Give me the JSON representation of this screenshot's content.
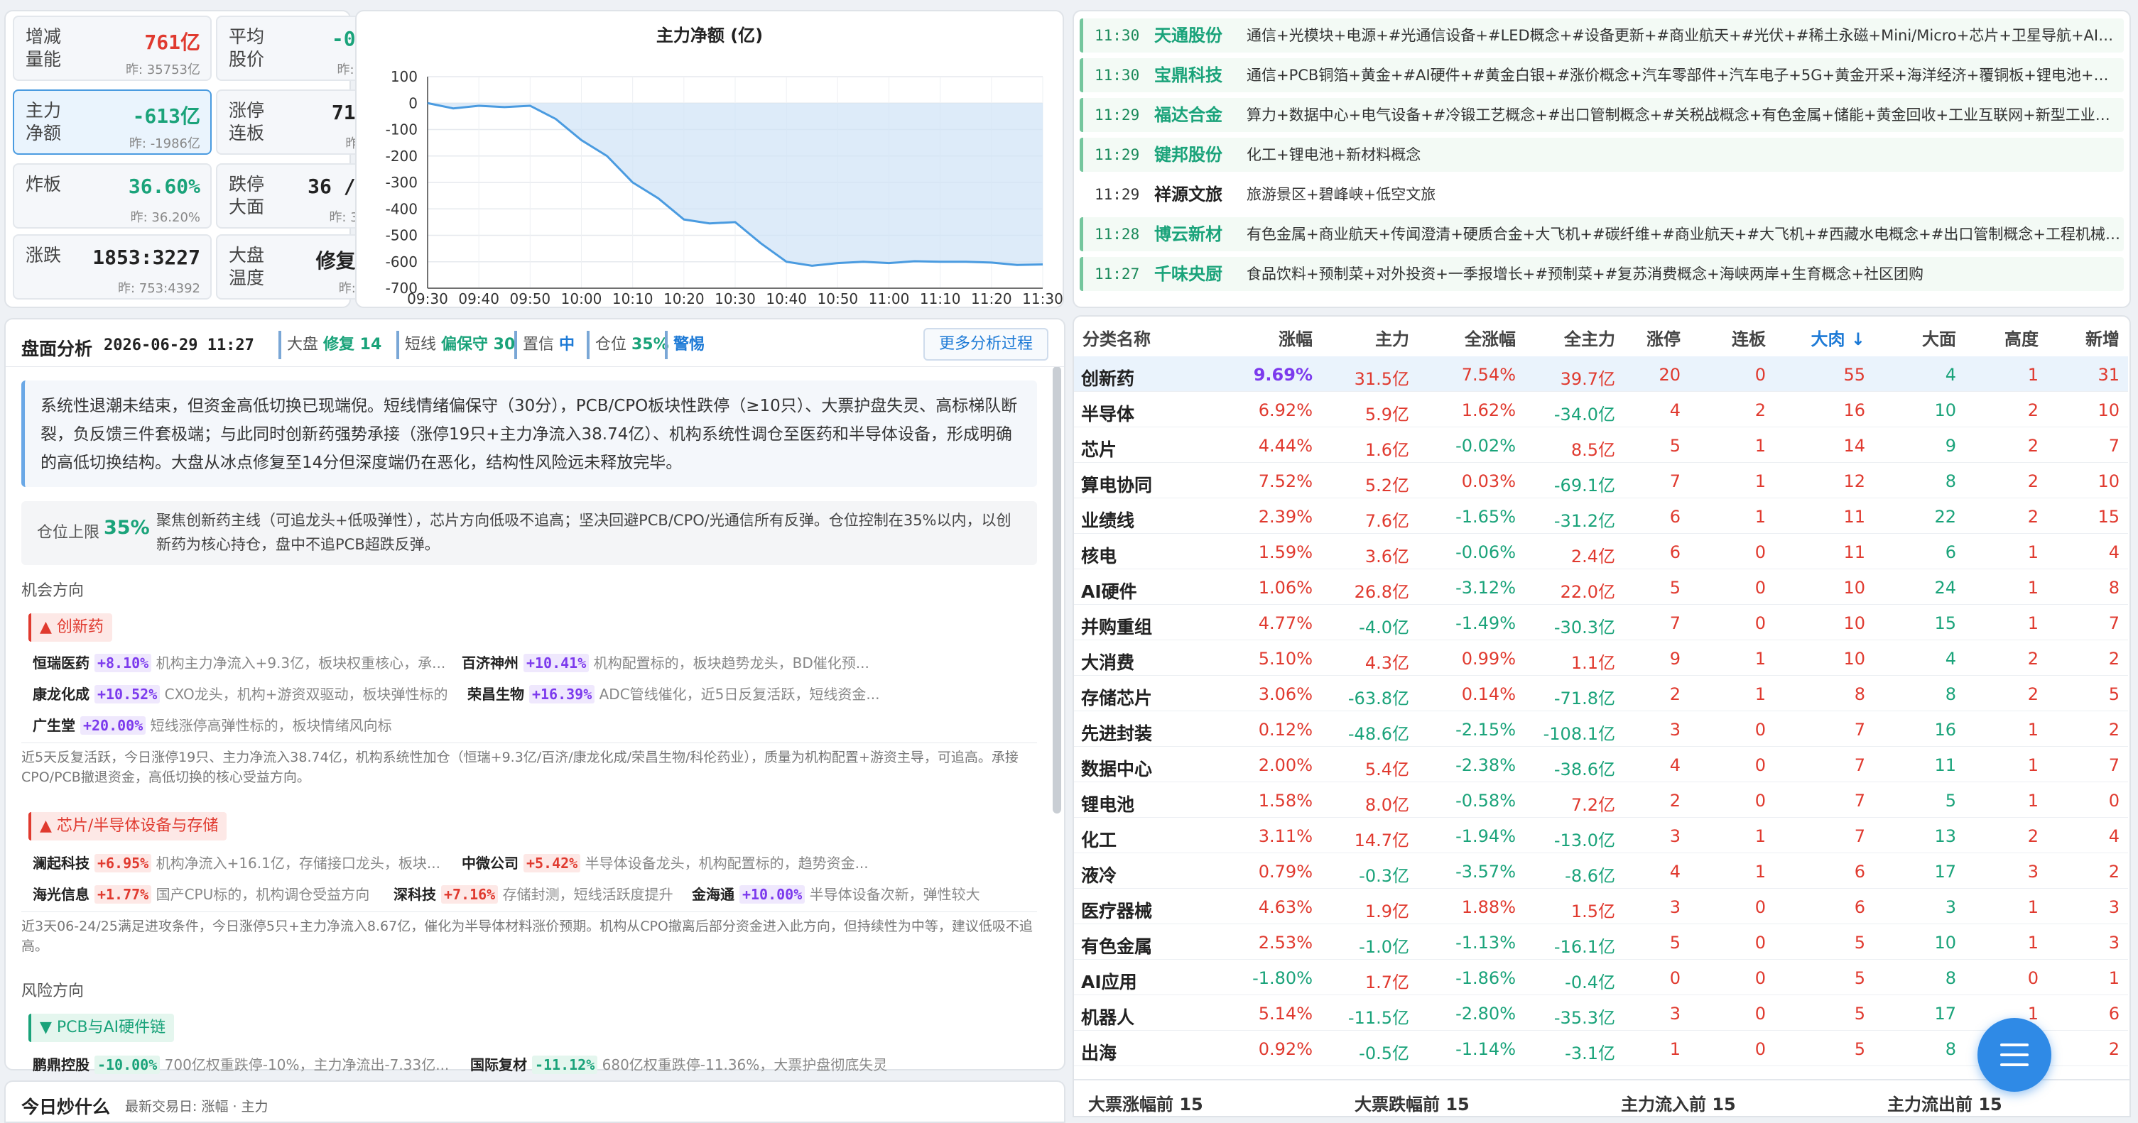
{
  "stats": [
    {
      "label": "增减量能",
      "value": "761亿",
      "prev": "昨: 35753亿",
      "color": "#e03a2f"
    },
    {
      "label": "平均股价",
      "value": "-0.90%",
      "prev": "昨: -2.53%",
      "color": "#1aa37a"
    },
    {
      "label": "主力净额",
      "value": "-613亿",
      "prev": "昨: -1986亿",
      "color": "#1aa37a"
    },
    {
      "label": "涨停连板",
      "value": "71 / 4",
      "prev": "昨: 60 / 8",
      "color": "#222"
    },
    {
      "label": "炸板",
      "value": "36.60%",
      "prev": "昨: 36.20%",
      "color": "#1aa37a"
    },
    {
      "label": "跌停大面",
      "value": "36 / 446",
      "prev": "昨: 30 / 375",
      "color": "#222"
    },
    {
      "label": "涨跌",
      "value": "1853:3227",
      "prev": "昨: 753:4392",
      "color": "#222"
    },
    {
      "label": "大盘温度",
      "value": "修复(14)",
      "prev": "昨: 冰点(8)",
      "color": "#222"
    }
  ],
  "chart_data": {
    "type": "area",
    "title": "主力净额 (亿)",
    "x": [
      "09:30",
      "09:35",
      "09:40",
      "09:45",
      "09:50",
      "09:55",
      "10:00",
      "10:05",
      "10:10",
      "10:15",
      "10:20",
      "10:25",
      "10:30",
      "10:35",
      "10:40",
      "10:45",
      "10:50",
      "10:55",
      "11:00",
      "11:05",
      "11:10",
      "11:15",
      "11:20",
      "11:25",
      "11:30"
    ],
    "values": [
      0,
      -20,
      -10,
      -15,
      -10,
      -60,
      -140,
      -200,
      -300,
      -360,
      -440,
      -455,
      -450,
      -530,
      -600,
      -615,
      -605,
      -600,
      -605,
      -598,
      -600,
      -600,
      -603,
      -612,
      -610
    ],
    "yticks": [
      100,
      0,
      -100,
      -200,
      -300,
      -400,
      -500,
      -600,
      -700
    ],
    "xticks": [
      "09:30",
      "09:40",
      "09:50",
      "10:00",
      "10:10",
      "10:20",
      "10:30",
      "10:40",
      "10:50",
      "11:00",
      "11:10",
      "11:20",
      "11:30"
    ],
    "ylim": [
      -700,
      100
    ],
    "color": "#4a9be0"
  },
  "news": [
    {
      "time": "11:30",
      "name": "天通股份",
      "content": "通信+光模块+电源+#光通信设备+#LED概念+#设备更新+#商业航天+#光伏+#稀土永磁+Mini/Micro+芯片+卫星导航+AI眼镜+乡村振...",
      "hl": true
    },
    {
      "time": "11:30",
      "name": "宝鼎科技",
      "content": "通信+PCB铜箔+黄金+#AI硬件+#黄金白银+#涨价概念+汽车零部件+汽车电子+5G+黄金开采+海洋经济+覆铜板+锂电池+锂电铜箔+海...",
      "hl": true
    },
    {
      "time": "11:29",
      "name": "福达合金",
      "content": "算力+数据中心+电气设备+#冷锻工艺概念+#出口管制概念+#关税战概念+有色金属+储能+黄金回收+工业互联网+新型工业化+高铁+轨...",
      "hl": true
    },
    {
      "time": "11:29",
      "name": "键邦股份",
      "content": "化工+锂电池+新材料概念",
      "hl": true
    },
    {
      "time": "11:29",
      "name": "祥源文旅",
      "content": "旅游景区+碧峰峡+低空文旅",
      "hl": false
    },
    {
      "time": "11:28",
      "name": "博云新材",
      "content": "有色金属+商业航天+传闻澄清+硬质合金+大飞机+#碳纤维+#商业航天+#大飞机+#西藏水电概念+#出口管制概念+工程机械+基础建设...",
      "hl": true
    },
    {
      "time": "11:27",
      "name": "千味央厨",
      "content": "食品饮料+预制菜+对外投资+一季报增长+#预制菜+#复苏消费概念+海峡两岸+生育概念+社区团购",
      "hl": true
    }
  ],
  "table": {
    "headers": [
      "分类名称",
      "涨幅",
      "主力",
      "全涨幅",
      "全主力",
      "涨停",
      "连板",
      "大肉",
      "大面",
      "高度",
      "新增"
    ],
    "sort_indicator": "↓",
    "rows": [
      [
        "创新药",
        "9.69%",
        "31.5亿",
        "7.54%",
        "39.7亿",
        "20",
        "0",
        "55",
        "4",
        "1",
        "31"
      ],
      [
        "半导体",
        "6.92%",
        "5.9亿",
        "1.62%",
        "-34.0亿",
        "4",
        "2",
        "16",
        "10",
        "2",
        "10"
      ],
      [
        "芯片",
        "4.44%",
        "1.6亿",
        "-0.02%",
        "8.5亿",
        "5",
        "1",
        "14",
        "9",
        "2",
        "7"
      ],
      [
        "算电协同",
        "7.52%",
        "5.2亿",
        "0.03%",
        "-69.1亿",
        "7",
        "1",
        "12",
        "8",
        "2",
        "10"
      ],
      [
        "业绩线",
        "2.39%",
        "7.6亿",
        "-1.65%",
        "-31.2亿",
        "6",
        "1",
        "11",
        "22",
        "2",
        "15"
      ],
      [
        "核电",
        "1.59%",
        "3.6亿",
        "-0.06%",
        "2.4亿",
        "6",
        "0",
        "11",
        "6",
        "1",
        "4"
      ],
      [
        "AI硬件",
        "1.06%",
        "26.8亿",
        "-3.12%",
        "22.0亿",
        "5",
        "0",
        "10",
        "24",
        "1",
        "8"
      ],
      [
        "并购重组",
        "4.77%",
        "-4.0亿",
        "-1.49%",
        "-30.3亿",
        "7",
        "0",
        "10",
        "15",
        "1",
        "7"
      ],
      [
        "大消费",
        "5.10%",
        "4.3亿",
        "0.99%",
        "1.1亿",
        "9",
        "1",
        "10",
        "4",
        "2",
        "2"
      ],
      [
        "存储芯片",
        "3.06%",
        "-63.8亿",
        "0.14%",
        "-71.8亿",
        "2",
        "1",
        "8",
        "8",
        "2",
        "5"
      ],
      [
        "先进封装",
        "0.12%",
        "-48.6亿",
        "-2.15%",
        "-108.1亿",
        "3",
        "0",
        "7",
        "16",
        "1",
        "2"
      ],
      [
        "数据中心",
        "2.00%",
        "5.4亿",
        "-2.38%",
        "-38.6亿",
        "4",
        "0",
        "7",
        "11",
        "1",
        "7"
      ],
      [
        "锂电池",
        "1.58%",
        "8.0亿",
        "-0.58%",
        "7.2亿",
        "2",
        "0",
        "7",
        "5",
        "1",
        "0"
      ],
      [
        "化工",
        "3.11%",
        "14.7亿",
        "-1.94%",
        "-13.0亿",
        "3",
        "1",
        "7",
        "13",
        "2",
        "4"
      ],
      [
        "液冷",
        "0.79%",
        "-0.3亿",
        "-3.57%",
        "-8.6亿",
        "4",
        "1",
        "6",
        "17",
        "3",
        "2"
      ],
      [
        "医疗器械",
        "4.63%",
        "1.9亿",
        "1.88%",
        "1.5亿",
        "3",
        "0",
        "6",
        "3",
        "1",
        "3"
      ],
      [
        "有色金属",
        "2.53%",
        "-1.0亿",
        "-1.13%",
        "-16.1亿",
        "5",
        "0",
        "5",
        "10",
        "1",
        "3"
      ],
      [
        "AI应用",
        "-1.80%",
        "1.7亿",
        "-1.86%",
        "-0.4亿",
        "0",
        "0",
        "5",
        "8",
        "0",
        "1"
      ],
      [
        "机器人",
        "5.14%",
        "-11.5亿",
        "-2.80%",
        "-35.3亿",
        "3",
        "0",
        "5",
        "17",
        "1",
        "6"
      ],
      [
        "出海",
        "0.92%",
        "-0.5亿",
        "-1.14%",
        "-3.1亿",
        "1",
        "0",
        "5",
        "8",
        "1",
        "2"
      ]
    ]
  },
  "bottom_tabs": [
    "大票涨幅前 15",
    "大票跌幅前 15",
    "主力流入前 15",
    "主力流出前 15"
  ],
  "analysis": {
    "title": "盘面分析",
    "datetime": "2026-06-29 11:27",
    "tags": [
      {
        "k": "大盘",
        "v": "修复",
        "n": "14"
      },
      {
        "k": "短线",
        "v": "偏保守",
        "n": "30"
      },
      {
        "k": "置信",
        "v": "中",
        "n": ""
      },
      {
        "k": "仓位",
        "v": "35%",
        "n": ""
      },
      {
        "k": "",
        "v": "警惕",
        "n": ""
      }
    ],
    "more_button": "更多分析过程",
    "summary": "系统性退潮未结束，但资金高低切换已现端倪。短线情绪偏保守（30分），PCB/CPO板块性跌停（≥10只）、大票护盘失灵、高标梯队断裂，负反馈三件套极端；与此同时创新药强势承接（涨停19只+主力净流入38.74亿）、机构系统性调仓至医药和半导体设备，形成明确的高低切换结构。大盘从冰点修复至14分但深度端仍在恶化，结构性风险远未释放完毕。",
    "position_label": "仓位上限",
    "position_value": "35%",
    "position_text": "聚焦创新药主线（可追龙头+低吸弹性），芯片方向低吸不追高；坚决回避PCB/CPO/光通信所有反弹。仓位控制在35%以内，以创新药为核心持仓，盘中不追PCB超跌反弹。",
    "opp_label": "机会方向",
    "risk_label": "风险方向",
    "cat1": "▲ 创新药",
    "cat1_stocks": [
      {
        "n": "恒瑞医药",
        "p": "+8.10%",
        "c": "p",
        "d": "机构主力净流入+9.3亿，板块权重核心，承..."
      },
      {
        "n": "百济神州",
        "p": "+10.41%",
        "c": "p",
        "d": "机构配置标的，板块趋势龙头，BD催化预..."
      },
      {
        "n": "康龙化成",
        "p": "+10.52%",
        "c": "p",
        "d": "CXO龙头，机构+游资双驱动，板块弹性标的"
      },
      {
        "n": "荣昌生物",
        "p": "+16.39%",
        "c": "p",
        "d": "ADC管线催化，近5日反复活跃，短线资金..."
      },
      {
        "n": "广生堂",
        "p": "+20.00%",
        "c": "p",
        "d": "短线涨停高弹性标的，板块情绪风向标"
      }
    ],
    "cat1_note": "近5天反复活跃，今日涨停19只、主力净流入38.74亿，机构系统性加仓（恒瑞+9.3亿/百济/康龙化成/荣昌生物/科伦药业），质量为机构配置+游资主导，可追高。承接CPO/PCB撤退资金，高低切换的核心受益方向。",
    "cat2": "▲ 芯片/半导体设备与存储",
    "cat2_stocks": [
      {
        "n": "澜起科技",
        "p": "+6.95%",
        "c": "r",
        "d": "机构净流入+16.1亿，存储接口龙头，板块..."
      },
      {
        "n": "中微公司",
        "p": "+5.42%",
        "c": "r",
        "d": "半导体设备龙头，机构配置标的，趋势资金..."
      },
      {
        "n": "海光信息",
        "p": "+1.77%",
        "c": "r",
        "d": "国产CPU标的，机构调仓受益方向"
      },
      {
        "n": "深科技",
        "p": "+7.16%",
        "c": "r",
        "d": "存储封测，短线活跃度提升"
      },
      {
        "n": "金海通",
        "p": "+10.00%",
        "c": "p",
        "d": "半导体设备次新，弹性较大"
      }
    ],
    "cat2_note": "近3天06-24/25满足进攻条件，今日涨停5只+主力净流入8.67亿，催化为半导体材料涨价预期。机构从CPO撤离后部分资金进入此方向，但持续性为中等，建议低吸不追高。",
    "cat3": "▼ PCB与AI硬件链",
    "cat3_stocks": [
      {
        "n": "鹏鼎控股",
        "p": "-10.00%",
        "c": "g",
        "d": "700亿权重跌停-10%，主力净流出-7.33亿..."
      },
      {
        "n": "国际复材",
        "p": "-11.12%",
        "c": "g",
        "d": "680亿权重跌停-11.36%，大票护盘彻底失灵"
      }
    ]
  },
  "footer": {
    "title": "今日炒什么",
    "sub": "最新交易日: 涨幅 · 主力"
  }
}
